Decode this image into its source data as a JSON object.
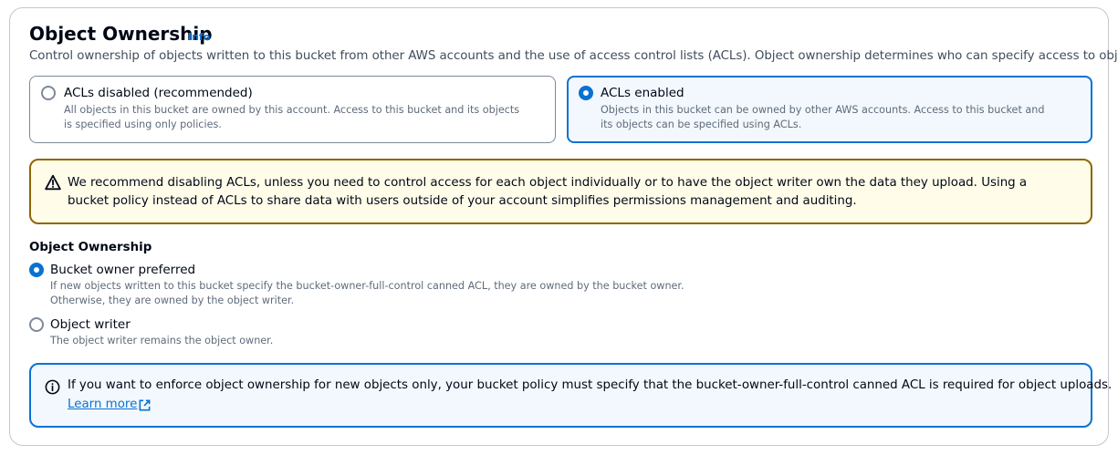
{
  "panel": {
    "title": "Object Ownership",
    "info_label": "Info",
    "description": "Control ownership of objects written to this bucket from other AWS accounts and the use of access control lists (ACLs). Object ownership determines who can specify access to objects."
  },
  "acl_options": [
    {
      "label": "ACLs disabled (recommended)",
      "description": "All objects in this bucket are owned by this account. Access to this bucket and its objects is specified using only policies.",
      "selected": false
    },
    {
      "label": "ACLs enabled",
      "description": "Objects in this bucket can be owned by other AWS accounts. Access to this bucket and its objects can be specified using ACLs.",
      "selected": true
    }
  ],
  "warning": {
    "icon": "warning-icon",
    "text": "We recommend disabling ACLs, unless you need to control access for each object individually or to have the object writer own the data they upload. Using a bucket policy instead of ACLs to share data with users outside of your account simplifies permissions management and auditing."
  },
  "ownership": {
    "label": "Object Ownership",
    "options": [
      {
        "label": "Bucket owner preferred",
        "description_line1": "If new objects written to this bucket specify the bucket-owner-full-control canned ACL, they are owned by the bucket owner.",
        "description_line2": "Otherwise, they are owned by the object writer.",
        "selected": true
      },
      {
        "label": "Object writer",
        "description_line1": "The object writer remains the object owner.",
        "selected": false
      }
    ]
  },
  "info_alert": {
    "icon": "info-icon",
    "text": "If you want to enforce object ownership for new objects only, your bucket policy must specify that the bucket-owner-full-control canned ACL is required for object uploads.",
    "link_label": "Learn more",
    "link_icon": "external-link-icon"
  },
  "colors": {
    "accent": "#0972d3",
    "warning_border": "#8d6605",
    "warning_bg": "#fffce9",
    "info_bg": "#f2f8fd"
  }
}
